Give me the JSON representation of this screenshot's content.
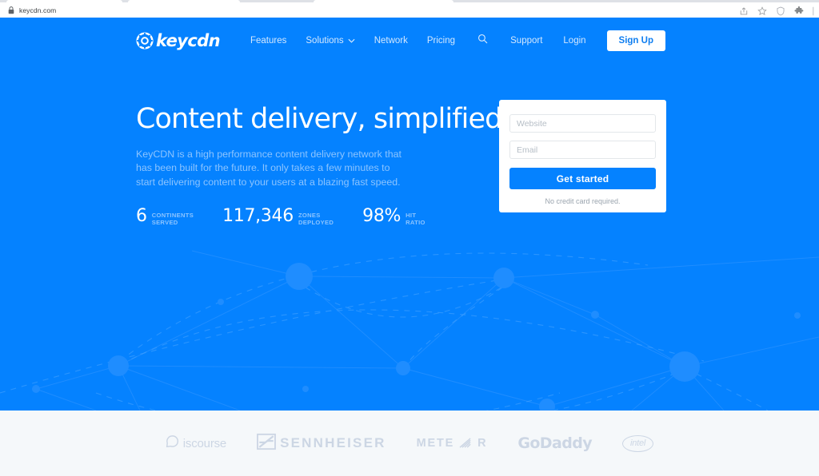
{
  "browser": {
    "url": "keycdn.com",
    "lock_icon": "lock-icon",
    "actions": [
      "share-icon",
      "bookmark-star-icon",
      "shield-icon",
      "extensions-puzzle-icon",
      "profile-icon"
    ]
  },
  "nav": {
    "logo_text": "keycdn",
    "logo_icon": "keycdn-logo-icon",
    "left_links": [
      {
        "label": "Features",
        "has_chevron": false
      },
      {
        "label": "Solutions",
        "has_chevron": true
      },
      {
        "label": "Network",
        "has_chevron": false
      },
      {
        "label": "Pricing",
        "has_chevron": false
      }
    ],
    "search_icon": "search-icon",
    "right_links": [
      {
        "label": "Support"
      },
      {
        "label": "Login"
      }
    ],
    "signup_label": "Sign Up"
  },
  "hero": {
    "headline": "Content delivery, simplified.",
    "subcopy": "KeyCDN is a high performance content delivery network that has been built for the future. It only takes a few minutes to start delivering content to your users at a blazing fast speed.",
    "stats": [
      {
        "value": "6",
        "label_line1": "CONTINENTS",
        "label_line2": "SERVED"
      },
      {
        "value": "117,346",
        "label_line1": "ZONES",
        "label_line2": "DEPLOYED"
      },
      {
        "value": "98%",
        "label_line1": "HIT",
        "label_line2": "RATIO"
      }
    ]
  },
  "signup_form": {
    "website_placeholder": "Website",
    "website_value": "",
    "email_placeholder": "Email",
    "email_value": "",
    "submit_label": "Get started",
    "note": "No credit card required."
  },
  "partners": [
    {
      "name": "Discourse",
      "text": "iscourse"
    },
    {
      "name": "Sennheiser",
      "text": "SENNHEISER"
    },
    {
      "name": "Meteor",
      "text_before": "METE",
      "text_after": "R"
    },
    {
      "name": "GoDaddy",
      "text": "GoDaddy"
    },
    {
      "name": "Intel",
      "text": "intel"
    }
  ],
  "colors": {
    "brand_blue": "#0582ff",
    "hero_subtext": "#8cc4ff",
    "partners_bg": "#f5f8fa",
    "partner_logo": "#ccd6e4",
    "signup_btn_text": "#0f7ef0"
  }
}
